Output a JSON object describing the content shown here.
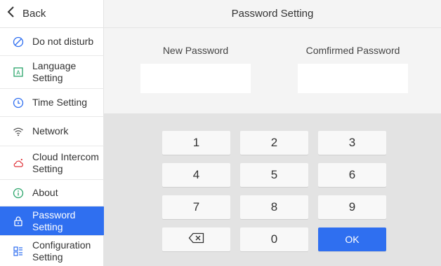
{
  "sidebar": {
    "back_label": "Back",
    "items": [
      {
        "label_lines": [
          "Do not disturb"
        ],
        "icon": "do-not-disturb-icon"
      },
      {
        "label_lines": [
          "Language",
          "Setting"
        ],
        "icon": "language-icon"
      },
      {
        "label_lines": [
          "Time Setting"
        ],
        "icon": "clock-icon"
      },
      {
        "label_lines": [
          "Network"
        ],
        "icon": "wifi-icon"
      },
      {
        "label_lines": [
          "Cloud Intercom",
          "Setting"
        ],
        "icon": "cloud-icon"
      },
      {
        "label_lines": [
          "About"
        ],
        "icon": "info-icon"
      },
      {
        "label_lines": [
          "Password",
          "Setting"
        ],
        "icon": "lock-icon",
        "active": true
      },
      {
        "label_lines": [
          "Configuration",
          "Setting"
        ],
        "icon": "configuration-icon"
      }
    ]
  },
  "header": {
    "title": "Password Setting"
  },
  "form": {
    "new_password_label": "New Password",
    "new_password_value": "",
    "confirm_password_label": "Comfirmed Password",
    "confirm_password_value": ""
  },
  "keypad": {
    "keys": [
      "1",
      "2",
      "3",
      "4",
      "5",
      "6",
      "7",
      "8",
      "9",
      "backspace",
      "0",
      "OK"
    ]
  },
  "colors": {
    "accent": "#2f6ff0",
    "panel_bg": "#f4f4f4",
    "keypad_bg": "#e3e3e3"
  }
}
